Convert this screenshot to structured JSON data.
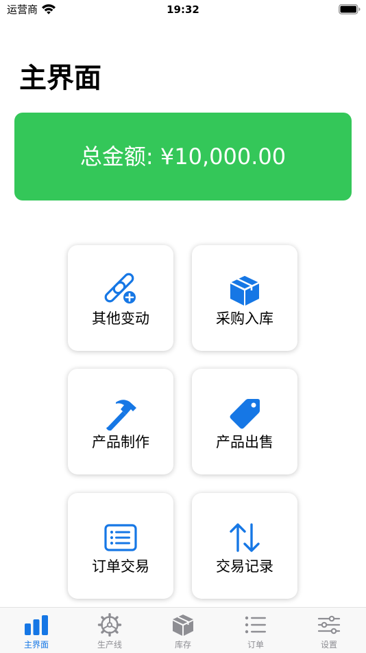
{
  "status_bar": {
    "carrier": "运营商",
    "time": "19:32",
    "wifi_icon": "wifi-icon",
    "battery_icon": "battery-icon"
  },
  "page": {
    "title": "主界面"
  },
  "total": {
    "text": "总金额: ¥10,000.00",
    "color": "#34c759"
  },
  "actions": [
    {
      "label": "其他变动",
      "icon": "link-plus-icon"
    },
    {
      "label": "采购入库",
      "icon": "box-icon"
    },
    {
      "label": "产品制作",
      "icon": "hammer-icon"
    },
    {
      "label": "产品出售",
      "icon": "tag-icon"
    },
    {
      "label": "订单交易",
      "icon": "list-rectangle-icon"
    },
    {
      "label": "交易记录",
      "icon": "arrows-up-down-icon"
    }
  ],
  "tabs": [
    {
      "label": "主界面",
      "icon": "chart-bar-icon",
      "active": true
    },
    {
      "label": "生产线",
      "icon": "gear-icon",
      "active": false
    },
    {
      "label": "库存",
      "icon": "box-icon",
      "active": false
    },
    {
      "label": "订单",
      "icon": "list-icon",
      "active": false
    },
    {
      "label": "设置",
      "icon": "sliders-icon",
      "active": false
    }
  ],
  "colors": {
    "accent": "#1677e5",
    "success": "#34c759",
    "tab_inactive": "#8e8e93"
  }
}
